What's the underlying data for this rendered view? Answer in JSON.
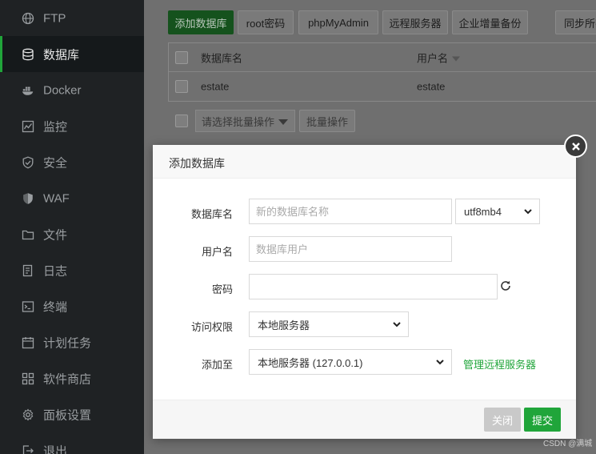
{
  "sidebar": {
    "items": [
      {
        "label": "FTP",
        "icon": "globe-icon"
      },
      {
        "label": "数据库",
        "icon": "database-icon",
        "active": true
      },
      {
        "label": "Docker",
        "icon": "docker-icon"
      },
      {
        "label": "监控",
        "icon": "monitor-icon"
      },
      {
        "label": "安全",
        "icon": "shield-icon"
      },
      {
        "label": "WAF",
        "icon": "waf-shield-icon"
      },
      {
        "label": "文件",
        "icon": "folder-icon"
      },
      {
        "label": "日志",
        "icon": "log-icon"
      },
      {
        "label": "终端",
        "icon": "terminal-icon"
      },
      {
        "label": "计划任务",
        "icon": "schedule-icon"
      },
      {
        "label": "软件商店",
        "icon": "grid-icon"
      },
      {
        "label": "面板设置",
        "icon": "gear-icon"
      },
      {
        "label": "退出",
        "icon": "logout-icon"
      }
    ],
    "accent": "#20a53a"
  },
  "toolbar": {
    "add_db": "添加数据库",
    "root_pwd": "root密码",
    "phpmyadmin": "phpMyAdmin",
    "remote_server": "远程服务器",
    "enterprise_backup": "企业增量备份",
    "sync_all": "同步所有"
  },
  "table": {
    "headers": {
      "name": "数据库名",
      "user": "用户名"
    },
    "rows": [
      {
        "name": "estate",
        "user": "estate"
      }
    ]
  },
  "batch": {
    "select_placeholder": "请选择批量操作",
    "button": "批量操作"
  },
  "dialog": {
    "title": "添加数据库",
    "fields": {
      "db_name_label": "数据库名",
      "db_name_placeholder": "新的数据库名称",
      "charset": "utf8mb4",
      "user_label": "用户名",
      "user_placeholder": "数据库用户",
      "password_label": "密码",
      "password_value": "",
      "access_label": "访问权限",
      "access_value": "本地服务器",
      "add_to_label": "添加至",
      "add_to_value": "本地服务器 (127.0.0.1)",
      "manage_remote_link": "管理远程服务器"
    },
    "buttons": {
      "close": "关闭",
      "submit": "提交"
    }
  },
  "watermark": "CSDN @满城"
}
